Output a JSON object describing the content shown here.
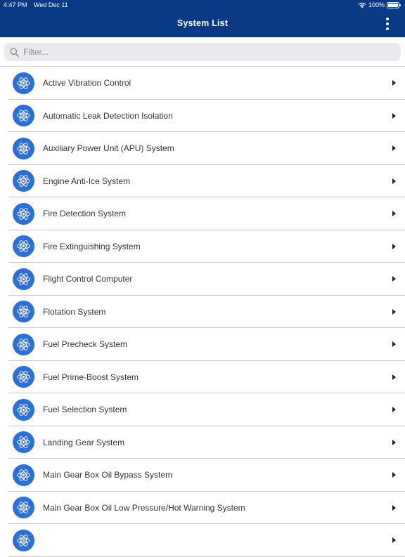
{
  "status_bar": {
    "time": "4:47 PM",
    "date": "Wed Dec 11",
    "battery": "100%"
  },
  "nav": {
    "title": "System List",
    "more_icon": "more-vertical-icon"
  },
  "search": {
    "placeholder": "Filter...",
    "value": ""
  },
  "list": {
    "icon": "atom-icon",
    "icon_color": "#2b6fd8",
    "items": [
      {
        "label": "Active Vibration Control"
      },
      {
        "label": "Automatic Leak Detection Isolation"
      },
      {
        "label": "Auxiliary Power Unit (APU) System"
      },
      {
        "label": "Engine Anti-Ice System"
      },
      {
        "label": "Fire Detection System"
      },
      {
        "label": "Fire Extinguishing System"
      },
      {
        "label": "Flight Control Computer"
      },
      {
        "label": "Flotation System"
      },
      {
        "label": "Fuel Precheck System"
      },
      {
        "label": "Fuel Prime-Boost System"
      },
      {
        "label": "Fuel Selection System"
      },
      {
        "label": "Landing Gear System"
      },
      {
        "label": "Main Gear Box Oil Bypass System"
      },
      {
        "label": "Main Gear Box Oil Low Pressure/Hot Warning System"
      },
      {
        "label": ""
      }
    ]
  },
  "colors": {
    "header": "#0a3a86",
    "accent": "#2b6fd8"
  }
}
